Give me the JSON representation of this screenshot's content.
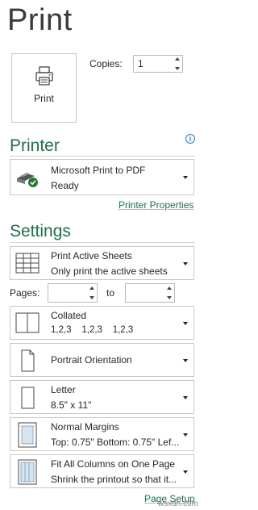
{
  "title": "Print",
  "print_button": {
    "label": "Print",
    "icon": "printer-icon"
  },
  "copies": {
    "label": "Copies:",
    "value": "1"
  },
  "printer": {
    "heading": "Printer",
    "name": "Microsoft Print to PDF",
    "status": "Ready",
    "properties_link": "Printer Properties",
    "info_icon": "info-icon"
  },
  "settings": {
    "heading": "Settings",
    "print_what": {
      "title": "Print Active Sheets",
      "subtitle": "Only print the active sheets"
    },
    "pages": {
      "label": "Pages:",
      "from": "",
      "to_label": "to",
      "to": ""
    },
    "collation": {
      "title": "Collated",
      "subtitle": "1,2,3    1,2,3    1,2,3"
    },
    "orientation": {
      "title": "Portrait Orientation"
    },
    "paper": {
      "title": "Letter",
      "subtitle": "8.5\" x 11\""
    },
    "margins": {
      "title": "Normal Margins",
      "subtitle": "Top: 0.75\" Bottom: 0.75\" Lef..."
    },
    "scaling": {
      "title": "Fit All Columns on One Page",
      "subtitle": "Shrink the printout so that it..."
    },
    "page_setup_link": "Page Setup"
  },
  "colors": {
    "accent": "#217346",
    "border": "#c8c8c8",
    "text": "#262626"
  },
  "watermark": "wsxdn.com"
}
